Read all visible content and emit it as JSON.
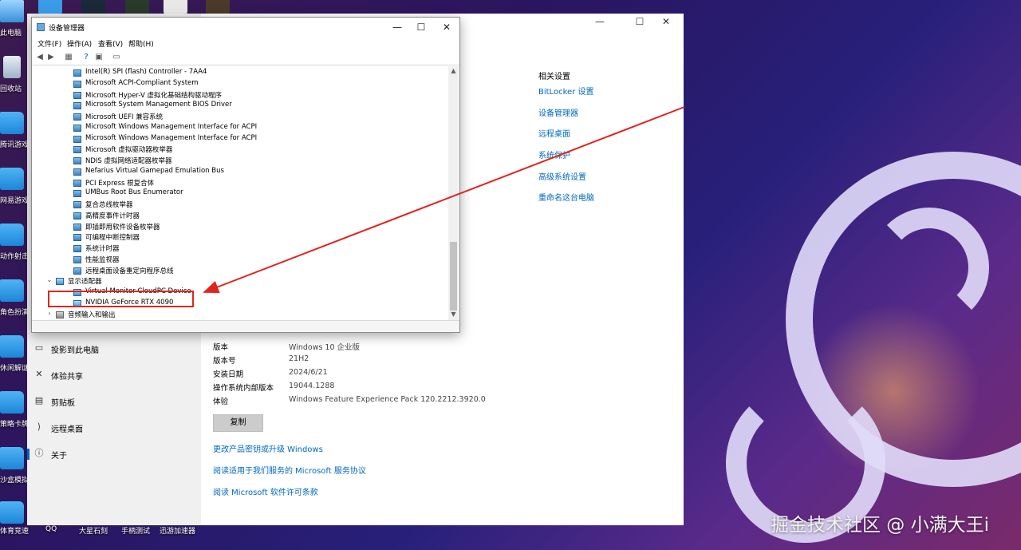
{
  "desktop": {
    "icons": [
      {
        "label": "此电脑",
        "type": "pc"
      },
      {
        "label": "回收站",
        "type": "bin"
      },
      {
        "label": "腾讯游戏",
        "type": "folder"
      },
      {
        "label": "网易游戏",
        "type": "folder"
      },
      {
        "label": "动作射击",
        "type": "folder"
      },
      {
        "label": "角色扮演",
        "type": "folder"
      },
      {
        "label": "休闲解谜",
        "type": "folder"
      },
      {
        "label": "策略卡牌",
        "type": "folder"
      },
      {
        "label": "沙盒模拟",
        "type": "folder"
      },
      {
        "label": "体育竞速",
        "type": "folder"
      }
    ],
    "bottom_labels": [
      "QQ",
      "大星石刻",
      "手柄测试",
      "迅游加速器"
    ]
  },
  "device_manager": {
    "title": "设备管理器",
    "window_buttons": {
      "minimize": "—",
      "maximize": "☐",
      "close": "✕"
    },
    "menu": [
      "文件(F)",
      "操作(A)",
      "查看(V)",
      "帮助(H)"
    ],
    "tree": [
      {
        "label": "Intel(R) SPI (flash) Controller - 7AA4",
        "level": 2
      },
      {
        "label": "Microsoft ACPI-Compliant System",
        "level": 2
      },
      {
        "label": "Microsoft Hyper-V 虚拟化基础结构驱动程序",
        "level": 2
      },
      {
        "label": "Microsoft System Management BIOS Driver",
        "level": 2
      },
      {
        "label": "Microsoft UEFI 兼容系统",
        "level": 2
      },
      {
        "label": "Microsoft Windows Management Interface for ACPI",
        "level": 2
      },
      {
        "label": "Microsoft Windows Management Interface for ACPI",
        "level": 2
      },
      {
        "label": "Microsoft 虚拟驱动器枚举器",
        "level": 2
      },
      {
        "label": "NDIS 虚拟网络适配器枚举器",
        "level": 2
      },
      {
        "label": "Nefarius Virtual Gamepad Emulation Bus",
        "level": 2
      },
      {
        "label": "PCI Express 根复合体",
        "level": 2
      },
      {
        "label": "UMBus Root Bus Enumerator",
        "level": 2
      },
      {
        "label": "复合总线枚举器",
        "level": 2
      },
      {
        "label": "高精度事件计时器",
        "level": 2
      },
      {
        "label": "即插即用软件设备枚举器",
        "level": 2
      },
      {
        "label": "可编程中断控制器",
        "level": 2
      },
      {
        "label": "系统计时器",
        "level": 2
      },
      {
        "label": "性能监视器",
        "level": 2
      },
      {
        "label": "远程桌面设备重定向程序总线",
        "level": 2
      },
      {
        "label": "显示适配器",
        "level": 1,
        "expander": "⌄",
        "kind": "category"
      },
      {
        "label": "Virtual Monitor CloudPC Device",
        "level": 2,
        "kind": "display"
      },
      {
        "label": "NVIDIA GeForce RTX 4090",
        "level": 2,
        "kind": "display"
      },
      {
        "label": "音频输入和输出",
        "level": 1,
        "expander": "›",
        "kind": "audio"
      }
    ]
  },
  "settings": {
    "window_buttons": {
      "minimize": "—",
      "maximize": "☐",
      "close": "✕"
    },
    "nav": [
      {
        "label": "投影到此电脑",
        "icon": "▭"
      },
      {
        "label": "体验共享",
        "icon": "✕"
      },
      {
        "label": "剪贴板",
        "icon": "▤"
      },
      {
        "label": "远程桌面",
        "icon": "⟩"
      },
      {
        "label": "关于",
        "icon": "ⓘ"
      }
    ],
    "related": {
      "heading": "相关设置",
      "links": [
        "BitLocker 设置",
        "设备管理器",
        "远程桌面",
        "系统保护",
        "高级系统设置",
        "重命名这台电脑"
      ]
    },
    "windows_spec": [
      {
        "key": "版本",
        "value": "Windows 10 企业版"
      },
      {
        "key": "版本号",
        "value": "21H2"
      },
      {
        "key": "安装日期",
        "value": "2024/6/21"
      },
      {
        "key": "操作系统内部版本",
        "value": "19044.1288"
      },
      {
        "key": "体验",
        "value": "Windows Feature Experience Pack 120.2212.3920.0"
      }
    ],
    "copy_button": "复制",
    "links": [
      "更改产品密钥或升级 Windows",
      "阅读适用于我们服务的 Microsoft 服务协议",
      "阅读 Microsoft 软件许可条款"
    ]
  },
  "watermark": "掘金技术社区 @ 小满大王i",
  "annotation": {
    "color": "#e0241f"
  }
}
